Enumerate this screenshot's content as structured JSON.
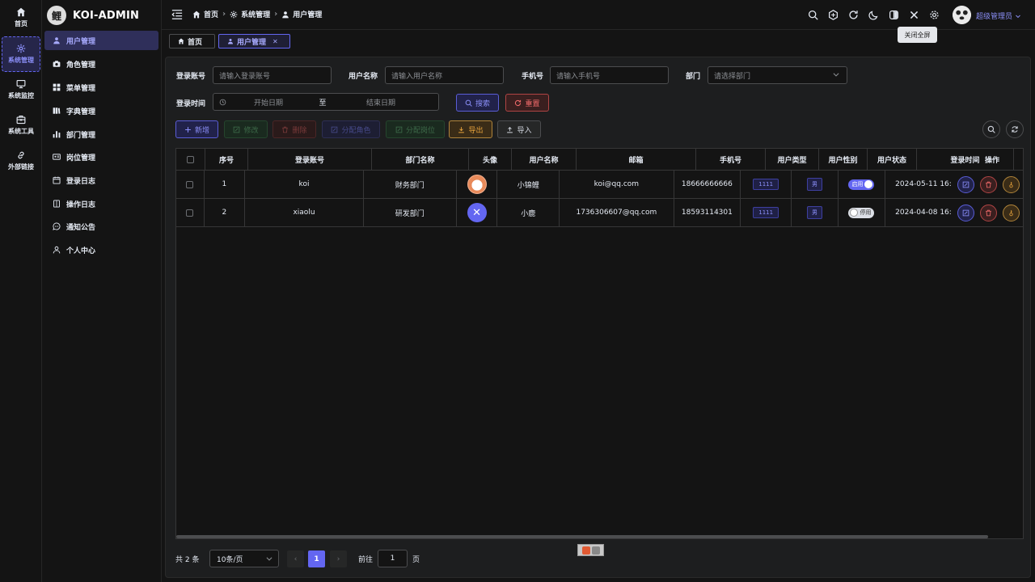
{
  "rail": [
    {
      "label": "首页",
      "icon": "home-icon"
    },
    {
      "label": "系统管理",
      "icon": "gear-icon"
    },
    {
      "label": "系统监控",
      "icon": "monitor-icon"
    },
    {
      "label": "系统工具",
      "icon": "toolbox-icon"
    },
    {
      "label": "外部链接",
      "icon": "link-icon"
    }
  ],
  "brand": {
    "name": "KOI-ADMIN"
  },
  "menu": [
    {
      "label": "用户管理",
      "icon": "user-icon"
    },
    {
      "label": "角色管理",
      "icon": "camera-icon"
    },
    {
      "label": "菜单管理",
      "icon": "grid-icon"
    },
    {
      "label": "字典管理",
      "icon": "book-icon"
    },
    {
      "label": "部门管理",
      "icon": "bar-chart-icon"
    },
    {
      "label": "岗位管理",
      "icon": "id-card-icon"
    },
    {
      "label": "登录日志",
      "icon": "calendar-icon"
    },
    {
      "label": "操作日志",
      "icon": "document-icon"
    },
    {
      "label": "通知公告",
      "icon": "chat-icon"
    },
    {
      "label": "个人中心",
      "icon": "person-icon"
    }
  ],
  "breadcrumb": [
    "首页",
    "系统管理",
    "用户管理"
  ],
  "user": {
    "name": "超级管理员"
  },
  "tooltip": "关闭全屏",
  "tabs": [
    "首页",
    "用户管理"
  ],
  "filters": {
    "login_account": {
      "label": "登录账号",
      "placeholder": "请输入登录账号"
    },
    "user_name": {
      "label": "用户名称",
      "placeholder": "请输入用户名称"
    },
    "phone": {
      "label": "手机号",
      "placeholder": "请输入手机号"
    },
    "dept": {
      "label": "部门",
      "placeholder": "请选择部门"
    },
    "login_time": {
      "label": "登录时间",
      "start": "开始日期",
      "sep": "至",
      "end": "结束日期"
    },
    "search": "搜索",
    "reset": "重置"
  },
  "toolbar": {
    "add": "新增",
    "edit": "修改",
    "delete": "删除",
    "assign_role": "分配角色",
    "assign_post": "分配岗位",
    "export": "导出",
    "import": "导入"
  },
  "table": {
    "columns": [
      "序号",
      "登录账号",
      "部门名称",
      "头像",
      "用户名称",
      "邮箱",
      "手机号",
      "用户类型",
      "用户性别",
      "用户状态",
      "登录时间",
      "操作"
    ],
    "rows": [
      {
        "index": "1",
        "account": "koi",
        "dept": "财务部门",
        "name": "小锦鲤",
        "email": "koi@qq.com",
        "phone": "18666666666",
        "type": "1111",
        "gender": "男",
        "status": "启用",
        "status_on": true,
        "time": "2024-05-11 16:"
      },
      {
        "index": "2",
        "account": "xiaolu",
        "dept": "研发部门",
        "name": "小鹿",
        "email": "1736306607@qq.com",
        "phone": "18593114301",
        "type": "1111",
        "gender": "男",
        "status": "停用",
        "status_on": false,
        "time": "2024-04-08 16:"
      }
    ]
  },
  "pagination": {
    "total": "共 2 条",
    "size": "10条/页",
    "prev": "‹",
    "current": "1",
    "next": "›",
    "goto": "前往",
    "jump_value": "1",
    "unit": "页"
  },
  "colors": {
    "accent": "#6366f1",
    "danger": "#f56c6c",
    "warning": "#e6a23c",
    "success": "#67c23a"
  }
}
